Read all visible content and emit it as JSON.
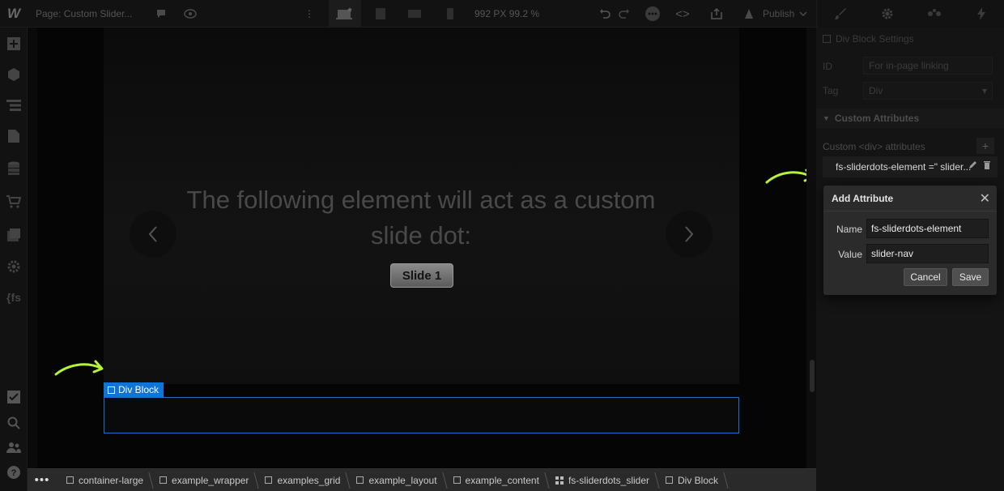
{
  "topbar": {
    "page_label": "Page: Custom Slider...",
    "width_readout": "992 PX  99.2 %",
    "publish_label": "Publish"
  },
  "canvas": {
    "headline": "The following element will act as a custom slide dot:",
    "slide_button": "Slide 1",
    "div_tag": "Div Block"
  },
  "right_panel": {
    "settings_title": "Div Block Settings",
    "id_label": "ID",
    "id_placeholder": "For in-page linking",
    "tag_label": "Tag",
    "tag_value": "Div",
    "custom_attributes_heading": "Custom Attributes",
    "custom_attributes_caption": "Custom <div> attributes",
    "existing_attribute": "fs-sliderdots-element =\" slider..."
  },
  "modal": {
    "title": "Add Attribute",
    "name_label": "Name",
    "name_value": "fs-sliderdots-element",
    "value_label": "Value",
    "value_value": "slider-nav",
    "cancel_label": "Cancel",
    "save_label": "Save"
  },
  "breadcrumbs": [
    "container-large",
    "example_wrapper",
    "examples_grid",
    "example_layout",
    "example_content",
    "fs-sliderdots_slider",
    "Div Block"
  ],
  "colors": {
    "accent": "#0d75d8",
    "highlight_arrow": "#b6f23a"
  }
}
